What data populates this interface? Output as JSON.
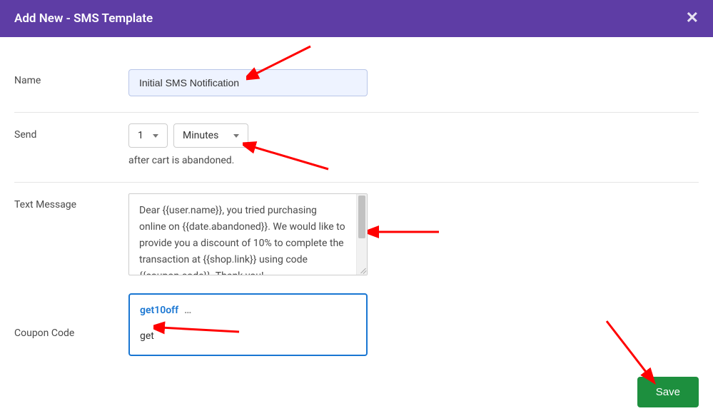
{
  "header": {
    "title": "Add New - SMS Template",
    "close_label": "✕"
  },
  "form": {
    "name": {
      "label": "Name",
      "value": "Initial SMS Notification"
    },
    "send": {
      "label": "Send",
      "number": "1",
      "unit": "Minutes",
      "helper": "after cart is abandoned."
    },
    "message": {
      "label": "Text Message",
      "value": "Dear {{user.name}}, you tried purchasing online on {{date.abandoned}}. We would like to provide you a discount of 10% to complete the transaction at {{shop.link}} using code {{coupon.code}}. Thank you!"
    },
    "coupon": {
      "label": "Coupon Code",
      "suggestion": "get10off",
      "typed": "get",
      "ellipsis": "…"
    }
  },
  "actions": {
    "save": "Save"
  }
}
